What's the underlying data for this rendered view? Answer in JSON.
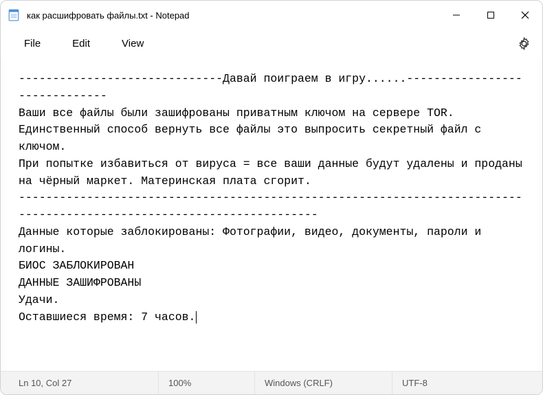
{
  "window": {
    "title": "как расшифровать файлы.txt - Notepad"
  },
  "menu": {
    "file": "File",
    "edit": "Edit",
    "view": "View"
  },
  "document": {
    "text": "------------------------------Давай поиграем в игру......------------------------------\nВаши все файлы были зашифрованы приватным ключом на сервере TOR.\nЕдинственный способ вернуть все файлы это выпросить секретный файл с ключом.\nПри попытке избавиться от вируса = все ваши данные будут удалены и проданы на чёрный маркет. Материнская плата сгорит.\n----------------------------------------------------------------------------------------------------------------------\nДанные которые заблокированы: Фотографии, видео, документы, пароли и логины.\nБИОС ЗАБЛОКИРОВАН\nДАННЫЕ ЗАШИФРОВАНЫ\nУдачи.\nОставшиеся время: 7 часов."
  },
  "status": {
    "position": "Ln 10, Col 27",
    "zoom": "100%",
    "eol": "Windows (CRLF)",
    "encoding": "UTF-8"
  }
}
